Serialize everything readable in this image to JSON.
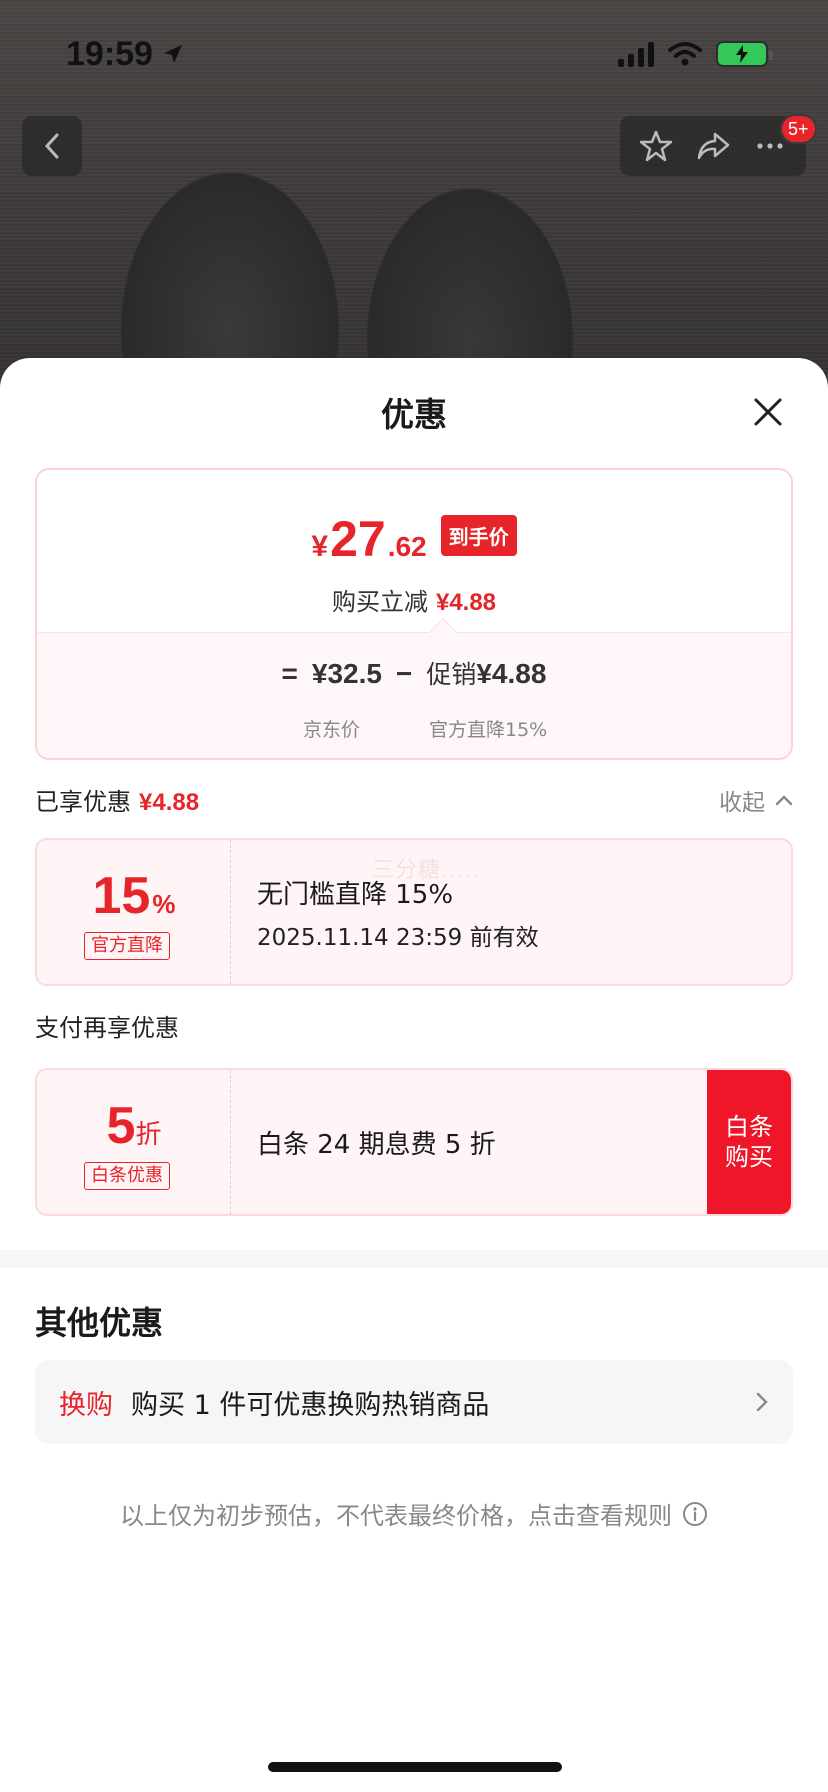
{
  "status_bar": {
    "time": "19:59"
  },
  "nav": {
    "badge": "5+"
  },
  "sheet": {
    "title": "优惠",
    "summary": {
      "currency": "¥",
      "price_int": "27",
      "price_dec": ".62",
      "price_tag": "到手价",
      "instant_cut_label": "购买立减",
      "instant_cut_value": "¥4.88",
      "equals": "=",
      "jd_price": "¥32.5",
      "minus": "−",
      "promo_label": "促销",
      "promo_value": "¥4.88",
      "jd_price_label": "京东价",
      "promo_sub_label": "官方直降15%"
    },
    "enjoyed": {
      "label": "已享优惠",
      "value": "¥4.88",
      "collapse_label": "收起"
    },
    "coupon1": {
      "num": "15",
      "unit": "%",
      "chip": "官方直降",
      "title": "无门槛直降 15%",
      "subtitle": "2025.11.14 23:59 前有效",
      "watermark": "三分糖....."
    },
    "pay_section": {
      "label": "支付再享优惠"
    },
    "coupon2": {
      "num": "5",
      "unit": "折",
      "chip": "白条优惠",
      "title": "白条 24 期息费 5 折",
      "action_line1": "白条",
      "action_line2": "购买"
    },
    "other": {
      "title": "其他优惠",
      "exchange_tag": "换购",
      "exchange_text": "购买 1 件可优惠换购热销商品"
    },
    "disclaimer": "以上仅为初步预估，不代表最终价格，点击查看规则"
  },
  "colors": {
    "accent": "#e6242a",
    "card_bg": "#fff5f6",
    "card_border": "#fbd9dc"
  }
}
